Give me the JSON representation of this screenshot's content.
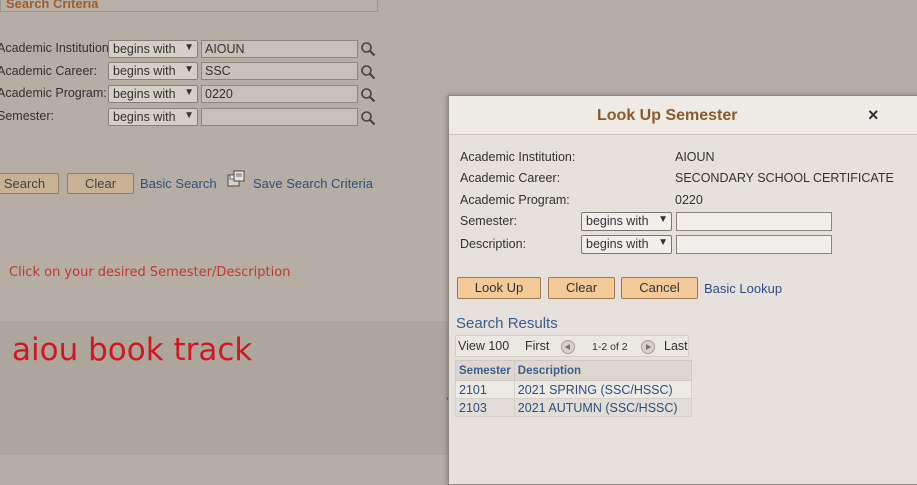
{
  "background": {
    "criteria_title": "Search Criteria",
    "rows": [
      {
        "label": "Academic Institution:",
        "operator": "begins with",
        "value": "AIOUN"
      },
      {
        "label": "Academic Career:",
        "operator": "begins with",
        "value": "SSC"
      },
      {
        "label": "Academic Program:",
        "operator": "begins with",
        "value": "0220"
      },
      {
        "label": "Semester:",
        "operator": "begins with",
        "value": ""
      }
    ],
    "search_button": "Search",
    "clear_button": "Clear",
    "basic_search_link": "Basic Search",
    "save_search_link": "Save Search Criteria",
    "instruction_note": "Click on your desired Semester/Description",
    "watermark_text": "aiou book track"
  },
  "modal": {
    "title": "Look Up Semester",
    "close_label": "×",
    "fields": [
      {
        "label": "Academic Institution:",
        "value": "AIOUN"
      },
      {
        "label": "Academic Career:",
        "value": "SECONDARY SCHOOL CERTIFICATE"
      },
      {
        "label": "Academic Program:",
        "value": "0220"
      }
    ],
    "semester_label": "Semester:",
    "semester_operator": "begins with",
    "description_label": "Description:",
    "description_operator": "begins with",
    "lookup_button": "Look Up",
    "clear_button": "Clear",
    "cancel_button": "Cancel",
    "basic_lookup_link": "Basic Lookup",
    "results": {
      "title": "Search Results",
      "view_all": "View 100",
      "first": "First",
      "range": "1-2 of 2",
      "last": "Last",
      "columns": [
        "Semester",
        "Description"
      ],
      "rows": [
        {
          "semester": "2101",
          "description": "2021 SPRING (SSC/HSSC)"
        },
        {
          "semester": "2103",
          "description": "2021 AUTUMN (SSC/HSSC)"
        }
      ]
    }
  }
}
